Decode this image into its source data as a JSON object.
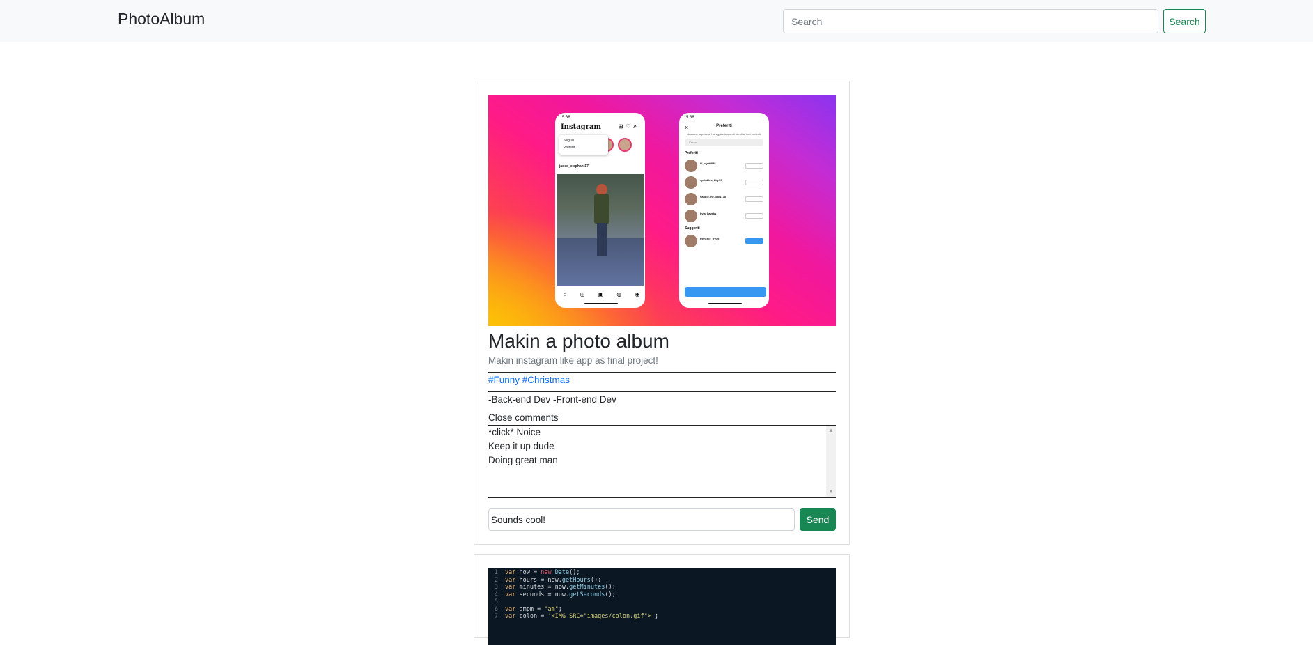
{
  "navbar": {
    "brand": "PhotoAlbum",
    "search_placeholder": "Search",
    "search_button": "Search"
  },
  "post": {
    "image": {
      "phone1": {
        "time": "5:38",
        "app_name": "Instagram",
        "menu": [
          "Seguiti",
          "Preferiti"
        ],
        "username": "jaded_elephant17",
        "nav_icons": [
          "home-icon",
          "explore-icon",
          "reels-icon",
          "shop-icon",
          "profile-icon"
        ]
      },
      "phone2": {
        "time": "5:38",
        "title": "Preferiti",
        "description": "Nessuno saprà che hai aggiunto questi utenti ai tuoi preferiti.",
        "search_placeholder": "Cerca",
        "section_favorites": "Preferiti",
        "section_suggested": "Suggeriti",
        "users": [
          "lil_wyatt838",
          "sprinkles_bby19",
          "sandie.the.crow178",
          "kyia_kayaks"
        ],
        "suggested_user": "frenchie_fry39",
        "confirm": "Conferma preferiti"
      }
    },
    "title": "Makin a photo album",
    "description": "Makin instagram like app as final project!",
    "tags": [
      "#Funny",
      "#Christmas"
    ],
    "roles": "-Back-end Dev -Front-end Dev",
    "toggle_comments": "Close comments",
    "comments": [
      "*click* Noice",
      "Keep it up dude",
      "Doing great man"
    ],
    "comment_input_value": "Sounds cool!",
    "send_button": "Send"
  },
  "post2": {
    "code_lines": [
      {
        "n": "1",
        "parts": [
          [
            "kw",
            "var "
          ],
          [
            "",
            "now = "
          ],
          [
            "nw",
            "new "
          ],
          [
            "fn",
            "Date"
          ],
          [
            "",
            "();"
          ]
        ]
      },
      {
        "n": "2",
        "parts": [
          [
            "kw",
            "var "
          ],
          [
            "",
            "hours = now."
          ],
          [
            "fn",
            "getHours"
          ],
          [
            "",
            "();"
          ]
        ]
      },
      {
        "n": "3",
        "parts": [
          [
            "kw",
            "var "
          ],
          [
            "",
            "minutes = now."
          ],
          [
            "fn",
            "getMinutes"
          ],
          [
            "",
            "();"
          ]
        ]
      },
      {
        "n": "4",
        "parts": [
          [
            "kw",
            "var "
          ],
          [
            "",
            "seconds = now."
          ],
          [
            "fn",
            "getSeconds"
          ],
          [
            "",
            "();"
          ]
        ]
      },
      {
        "n": "5",
        "parts": []
      },
      {
        "n": "6",
        "parts": [
          [
            "kw",
            "var "
          ],
          [
            "",
            "ampm = "
          ],
          [
            "st",
            "\"am\""
          ],
          [
            "",
            ";"
          ]
        ]
      },
      {
        "n": "7",
        "parts": [
          [
            "kw",
            "var "
          ],
          [
            "",
            "colon = "
          ],
          [
            "st",
            "'<IMG SRC=\"images/colon.gif\">'"
          ],
          [
            "",
            ";"
          ]
        ]
      }
    ]
  }
}
